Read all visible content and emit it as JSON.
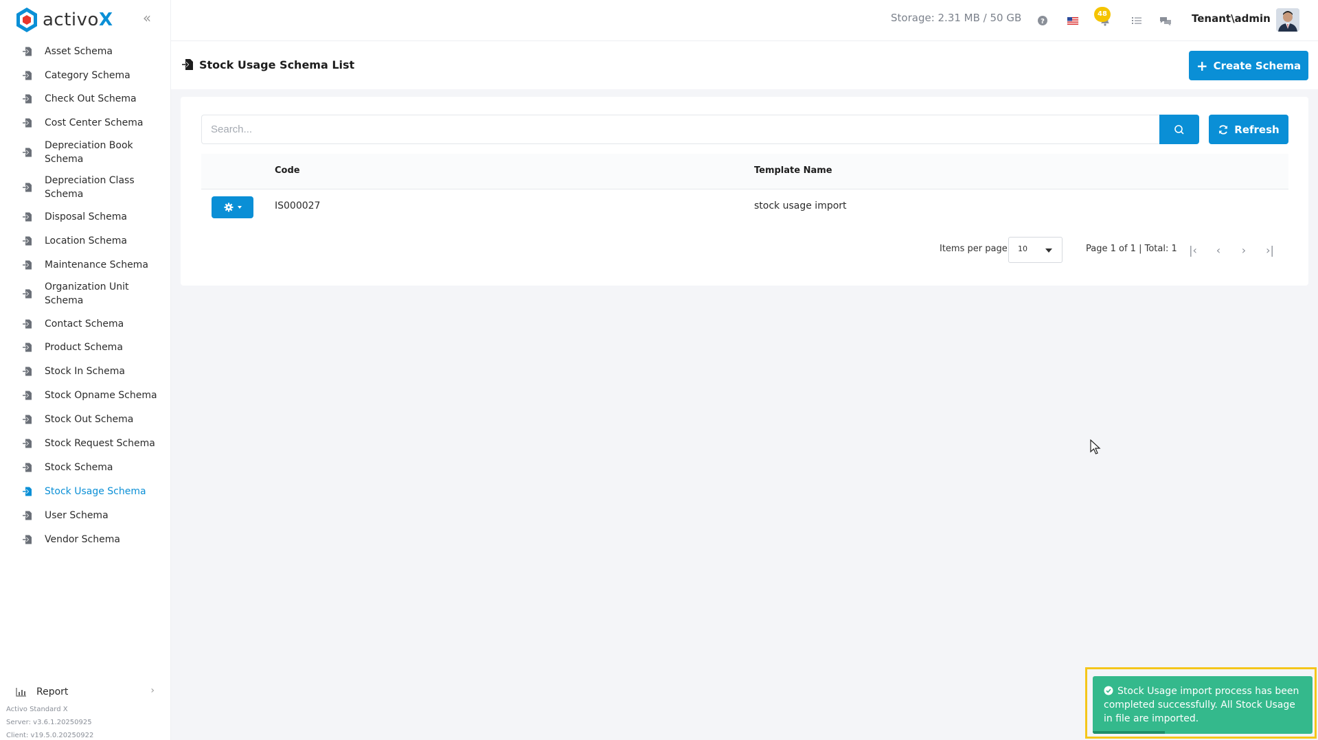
{
  "brand": {
    "name_part1": "activo",
    "name_part2": "X",
    "accent_color": "#0a8fd6"
  },
  "sidebar": {
    "items": [
      {
        "label": "Asset Schema"
      },
      {
        "label": "Category Schema"
      },
      {
        "label": "Check Out Schema"
      },
      {
        "label": "Cost Center Schema"
      },
      {
        "label": "Depreciation Book Schema"
      },
      {
        "label": "Depreciation Class Schema"
      },
      {
        "label": "Disposal Schema"
      },
      {
        "label": "Location Schema"
      },
      {
        "label": "Maintenance Schema"
      },
      {
        "label": "Organization Unit Schema"
      },
      {
        "label": "Contact Schema"
      },
      {
        "label": "Product Schema"
      },
      {
        "label": "Stock In Schema"
      },
      {
        "label": "Stock Opname Schema"
      },
      {
        "label": "Stock Out Schema"
      },
      {
        "label": "Stock Request Schema"
      },
      {
        "label": "Stock Schema"
      },
      {
        "label": "Stock Usage Schema",
        "active": true
      },
      {
        "label": "User Schema"
      },
      {
        "label": "Vendor Schema"
      }
    ],
    "report_label": "Report",
    "versions": {
      "edition": "Activo Standard X",
      "server": "Server: v3.6.1.20250925",
      "client": "Client: v19.5.0.20250922"
    }
  },
  "topbar": {
    "storage": "Storage: 2.31 MB / 50 GB",
    "notification_count": "48",
    "user": "Tenant\\admin"
  },
  "page": {
    "title": "Stock Usage Schema List",
    "create_label": "Create Schema"
  },
  "search": {
    "placeholder": "Search...",
    "refresh_label": "Refresh"
  },
  "table": {
    "columns": {
      "code": "Code",
      "template_name": "Template Name"
    },
    "rows": [
      {
        "code": "IS000027",
        "template_name": "stock usage import"
      }
    ]
  },
  "pagination": {
    "items_per_page_label": "Items per page",
    "items_per_page": "10",
    "info": "Page 1 of 1 | Total: 1"
  },
  "toast": {
    "message": "Stock Usage import process has been completed successfully. All Stock Usage in file are imported.",
    "color": "#34b98c"
  }
}
